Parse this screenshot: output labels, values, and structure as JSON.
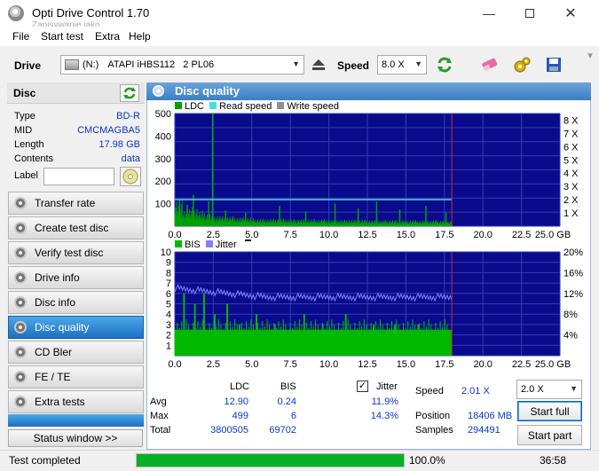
{
  "window": {
    "title": "Opti Drive Control 1.70",
    "subtitle_ghost": "Zapisywanie jako"
  },
  "menu": [
    "File",
    "Start test",
    "Extra",
    "Help"
  ],
  "toolbar": {
    "drive_label": "Drive",
    "drive_letter": "(N:)",
    "drive_name": "ATAPI iHBS112   2 PL06",
    "speed_label": "Speed",
    "speed_value": "8.0 X"
  },
  "disc": {
    "header": "Disc",
    "rows": [
      {
        "key": "Type",
        "value": "BD-R"
      },
      {
        "key": "MID",
        "value": "CMCMAGBA5"
      },
      {
        "key": "Length",
        "value": "17.98 GB"
      },
      {
        "key": "Contents",
        "value": "data"
      }
    ],
    "label_key": "Label",
    "label_value": ""
  },
  "nav": [
    "Transfer rate",
    "Create test disc",
    "Verify test disc",
    "Drive info",
    "Disc info",
    "Disc quality",
    "CD Bler",
    "FE / TE",
    "Extra tests"
  ],
  "nav_active": "Disc quality",
  "status_window": "Status window >>",
  "panel_title": "Disc quality",
  "chart_data": [
    {
      "type": "area",
      "legend": [
        "LDC",
        "Read speed",
        "Write speed"
      ],
      "colors": {
        "ldc": "#00a000",
        "read": "#40e0e8",
        "write": "#909090"
      },
      "xlim": [
        0,
        25
      ],
      "ylim": [
        0,
        500
      ],
      "x_ticks": [
        "0.0",
        "2.5",
        "5.0",
        "7.5",
        "10.0",
        "12.5",
        "15.0",
        "17.5",
        "20.0",
        "22.5",
        "25.0 GB"
      ],
      "y_ticks": [
        "500",
        "400",
        "300",
        "200",
        "100"
      ],
      "y2_ticks": [
        "8 X",
        "7 X",
        "6 X",
        "5 X",
        "4 X",
        "3 X",
        "2 X",
        "1 X"
      ],
      "ldc_profile": [
        [
          0,
          55
        ],
        [
          0.5,
          35
        ],
        [
          1,
          38
        ],
        [
          1.5,
          30
        ],
        [
          2,
          25
        ],
        [
          2.5,
          22
        ],
        [
          3,
          20
        ],
        [
          4,
          18
        ],
        [
          5,
          15
        ],
        [
          7.5,
          14
        ],
        [
          10,
          13
        ],
        [
          12.5,
          12
        ],
        [
          15,
          12
        ],
        [
          17.5,
          11
        ],
        [
          17.98,
          10
        ]
      ],
      "ldc_spikes": [
        [
          0.3,
          120
        ],
        [
          0.8,
          95
        ],
        [
          1.2,
          140
        ],
        [
          2.2,
          110
        ],
        [
          2.45,
          499
        ],
        [
          3.3,
          70
        ],
        [
          4.6,
          60
        ],
        [
          6.8,
          90
        ],
        [
          8.5,
          65
        ],
        [
          10.4,
          100
        ],
        [
          11.9,
          80
        ],
        [
          13.1,
          110
        ],
        [
          14.6,
          75
        ],
        [
          16.3,
          90
        ],
        [
          17.6,
          60
        ]
      ],
      "read_speed": 2.01,
      "end_gb": 17.98
    },
    {
      "type": "area",
      "legend": [
        "BIS",
        "Jitter"
      ],
      "colors": {
        "bis": "#00b800",
        "jitter": "#8080ff"
      },
      "xlim": [
        0,
        25
      ],
      "ylim": [
        0,
        10
      ],
      "y2lim": [
        0,
        20
      ],
      "x_ticks": [
        "0.0",
        "2.5",
        "5.0",
        "7.5",
        "10.0",
        "12.5",
        "15.0",
        "17.5",
        "20.0",
        "22.5",
        "25.0 GB"
      ],
      "y_ticks": [
        "10",
        "9",
        "8",
        "7",
        "6",
        "5",
        "4",
        "3",
        "2",
        "1"
      ],
      "y2_ticks": [
        "20%",
        "16%",
        "12%",
        "8%",
        "4%"
      ],
      "bis_base": 2.5,
      "bis_spikes": [
        [
          0.6,
          6
        ],
        [
          1.3,
          5
        ],
        [
          1.9,
          6
        ],
        [
          2.6,
          4
        ],
        [
          3.4,
          5
        ],
        [
          4.2,
          3
        ],
        [
          5.3,
          4
        ],
        [
          6.5,
          3
        ],
        [
          8.4,
          4
        ],
        [
          9.6,
          3
        ],
        [
          11.1,
          4
        ],
        [
          12.9,
          3
        ],
        [
          14.3,
          3
        ],
        [
          15.8,
          3
        ],
        [
          17.2,
          2
        ]
      ],
      "jitter_start": 13.0,
      "jitter_mean": 11.9,
      "jitter_max": 14.3,
      "end_gb": 17.98
    }
  ],
  "stats": {
    "col_ldc": "LDC",
    "col_bis": "BIS",
    "col_jitter": "Jitter",
    "jitter_checked": true,
    "rows": [
      {
        "label": "Avg",
        "ldc": "12.90",
        "bis": "0.24",
        "jitter": "11.9%"
      },
      {
        "label": "Max",
        "ldc": "499",
        "bis": "6",
        "jitter": "14.3%"
      },
      {
        "label": "Total",
        "ldc": "3800505",
        "bis": "69702",
        "jitter": ""
      }
    ],
    "speed_label": "Speed",
    "speed_value": "2.01 X",
    "position_label": "Position",
    "position_value": "18406 MB",
    "samples_label": "Samples",
    "samples_value": "294491",
    "speed_select": "2.0 X",
    "start_full": "Start full",
    "start_part": "Start part"
  },
  "status": {
    "text": "Test completed",
    "progress": 1.0,
    "progress_text": "100.0%",
    "time": "36:58"
  }
}
